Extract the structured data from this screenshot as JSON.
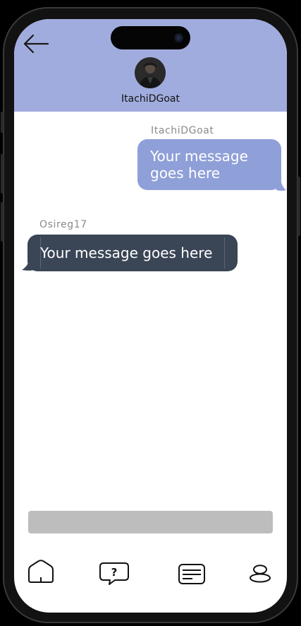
{
  "header": {
    "contact_name": "ItachiDGoat",
    "background_color": "#a1acde",
    "icons": {
      "back": "arrow-left-icon",
      "avatar": "profile-photo"
    }
  },
  "messages": [
    {
      "sender": "ItachiDGoat",
      "text": "Your message goes here",
      "direction": "outgoing",
      "bubble_color": "#8f9fd8"
    },
    {
      "sender": "Osireg17",
      "text": "Your message goes here",
      "direction": "incoming",
      "bubble_color": "#3a4556"
    }
  ],
  "composer": {
    "value": "",
    "placeholder": ""
  },
  "bottom_nav": {
    "items": [
      {
        "icon": "home-icon"
      },
      {
        "icon": "help-chat-icon"
      },
      {
        "icon": "messages-icon"
      },
      {
        "icon": "profile-icon"
      }
    ]
  }
}
